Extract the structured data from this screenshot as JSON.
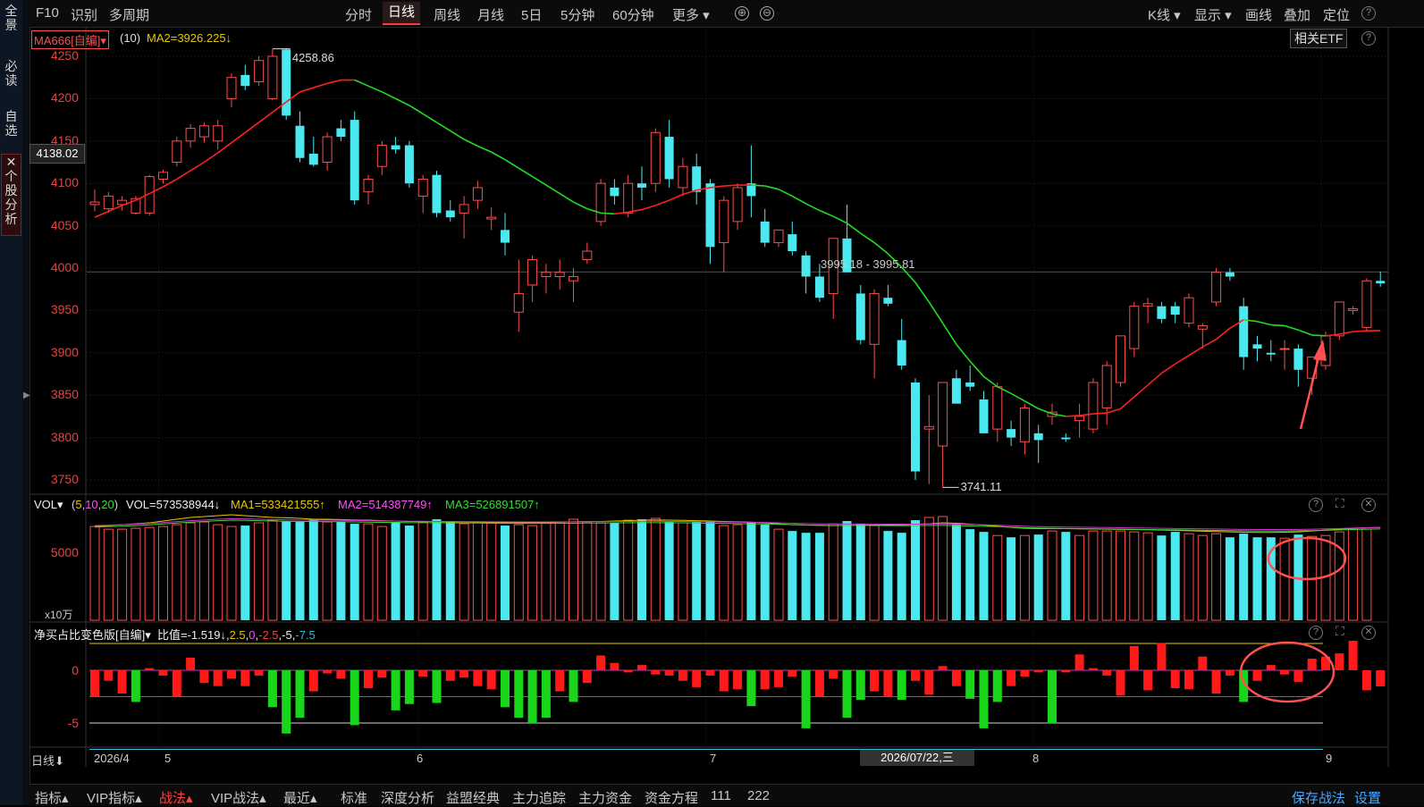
{
  "leftbar": {
    "tabs": [
      {
        "label": "全景"
      },
      {
        "label": "必读"
      },
      {
        "label": "自选"
      },
      {
        "label": "✕个股分析"
      }
    ]
  },
  "topbar": {
    "left": [
      "F10",
      "识别",
      "多周期"
    ],
    "periods": [
      "分时",
      "日线",
      "周线",
      "月线",
      "5日",
      "5分钟",
      "60分钟",
      "更多 ▾"
    ],
    "active_period": "日线",
    "zoom_in": "⊕",
    "zoom_out": "⊖",
    "right": [
      "K线 ▾",
      "显示 ▾",
      "画线",
      "叠加",
      "定位"
    ],
    "help": "?"
  },
  "main_panel": {
    "indicator_name": "MA666[自编]▾",
    "param": "(10)",
    "ma2_label": "MA2=3926.225↓",
    "etf_button": "相关ETF",
    "help": "?",
    "current_price": "4138.02",
    "high_label": "4258.86",
    "low_label": "3741.11",
    "range_label": "3995.18 - 3995.81",
    "y_ticks": [
      "4250",
      "4200",
      "4150",
      "4100",
      "4050",
      "4000",
      "3950",
      "3900",
      "3850",
      "3800",
      "3750"
    ]
  },
  "vol_panel": {
    "name": "VOL▾",
    "params_open": "(",
    "p1": "5",
    "p2": "10",
    "p3": "20",
    "params_close": ")",
    "vol": "VOL=573538944↓",
    "ma1": "MA1=533421555↑",
    "ma2": "MA2=514387749↑",
    "ma3": "MA3=526891507↑",
    "y_tick": "5000",
    "unit": "x10万"
  },
  "net_panel": {
    "name": "净买占比变色版[自编]▾",
    "ratio": "比值=-1.519↓",
    "v1": "2.5",
    "v2": "0",
    "v3": "-2.5",
    "v4": "-5",
    "v5": "-7.5",
    "y_ticks": [
      "0",
      "-5"
    ]
  },
  "xaxis": {
    "period_label": "日线⬇",
    "ticks": [
      "2026/4",
      "5",
      "6",
      "7",
      "8",
      "9"
    ],
    "cursor_date": "2026/07/22,三"
  },
  "bottombar": {
    "items": [
      "指标▴",
      "VIP指标▴",
      "战法▴",
      "VIP战法▴",
      "最近▴",
      "标准",
      "深度分析",
      "益盟经典",
      "主力追踪",
      "主力资金",
      "资金方程",
      "111",
      "222"
    ],
    "active_item": "战法▴",
    "right": [
      "保存战法",
      "设置"
    ]
  },
  "colors": {
    "up": "#ff4d4d",
    "down": "#4be8f0",
    "ma_up": "#ff2020",
    "ma_down": "#22dd22",
    "vol_up_fill": "#000000",
    "net_pos": "#ff1a1a",
    "net_neg": "#1ad61a",
    "annotation": "#ff5050"
  },
  "chart_data": {
    "type": "candlestick",
    "title": "",
    "price_range": [
      3730,
      4265
    ],
    "candles": [
      {
        "o": 4075,
        "h": 4093,
        "l": 4067,
        "c": 4078
      },
      {
        "o": 4070,
        "h": 4090,
        "l": 4065,
        "c": 4085
      },
      {
        "o": 4075,
        "h": 4085,
        "l": 4068,
        "c": 4080
      },
      {
        "o": 4065,
        "h": 4085,
        "l": 4063,
        "c": 4082
      },
      {
        "o": 4065,
        "h": 4110,
        "l": 4062,
        "c": 4108
      },
      {
        "o": 4105,
        "h": 4116,
        "l": 4100,
        "c": 4113
      },
      {
        "o": 4125,
        "h": 4155,
        "l": 4120,
        "c": 4150
      },
      {
        "o": 4150,
        "h": 4170,
        "l": 4142,
        "c": 4165
      },
      {
        "o": 4155,
        "h": 4172,
        "l": 4148,
        "c": 4168
      },
      {
        "o": 4150,
        "h": 4175,
        "l": 4140,
        "c": 4168
      },
      {
        "o": 4200,
        "h": 4230,
        "l": 4190,
        "c": 4225
      },
      {
        "o": 4228,
        "h": 4240,
        "l": 4210,
        "c": 4215
      },
      {
        "o": 4220,
        "h": 4250,
        "l": 4215,
        "c": 4245
      },
      {
        "o": 4200,
        "h": 4258.86,
        "l": 4198,
        "c": 4250
      },
      {
        "o": 4258,
        "h": 4259,
        "l": 4175,
        "c": 4180
      },
      {
        "o": 4168,
        "h": 4185,
        "l": 4125,
        "c": 4130
      },
      {
        "o": 4135,
        "h": 4155,
        "l": 4120,
        "c": 4122
      },
      {
        "o": 4125,
        "h": 4160,
        "l": 4115,
        "c": 4155
      },
      {
        "o": 4165,
        "h": 4175,
        "l": 4150,
        "c": 4155
      },
      {
        "o": 4175,
        "h": 4185,
        "l": 4075,
        "c": 4080
      },
      {
        "o": 4090,
        "h": 4110,
        "l": 4075,
        "c": 4105
      },
      {
        "o": 4120,
        "h": 4150,
        "l": 4110,
        "c": 4145
      },
      {
        "o": 4145,
        "h": 4155,
        "l": 4135,
        "c": 4140
      },
      {
        "o": 4145,
        "h": 4150,
        "l": 4095,
        "c": 4100
      },
      {
        "o": 4085,
        "h": 4110,
        "l": 4065,
        "c": 4105
      },
      {
        "o": 4110,
        "h": 4115,
        "l": 4060,
        "c": 4065
      },
      {
        "o": 4068,
        "h": 4080,
        "l": 4055,
        "c": 4060
      },
      {
        "o": 4065,
        "h": 4085,
        "l": 4035,
        "c": 4075
      },
      {
        "o": 4080,
        "h": 4103,
        "l": 4070,
        "c": 4095
      },
      {
        "o": 4058,
        "h": 4072,
        "l": 4045,
        "c": 4060
      },
      {
        "o": 4045,
        "h": 4065,
        "l": 4015,
        "c": 4030
      },
      {
        "o": 3948,
        "h": 4010,
        "l": 3925,
        "c": 3970
      },
      {
        "o": 3980,
        "h": 4015,
        "l": 3960,
        "c": 4010
      },
      {
        "o": 3990,
        "h": 4005,
        "l": 3970,
        "c": 3995
      },
      {
        "o": 3990,
        "h": 4010,
        "l": 3975,
        "c": 3995
      },
      {
        "o": 3985,
        "h": 4000,
        "l": 3960,
        "c": 3990
      },
      {
        "o": 4010,
        "h": 4030,
        "l": 4005,
        "c": 4020
      },
      {
        "o": 4055,
        "h": 4105,
        "l": 4050,
        "c": 4100
      },
      {
        "o": 4095,
        "h": 4105,
        "l": 4075,
        "c": 4085
      },
      {
        "o": 4065,
        "h": 4110,
        "l": 4060,
        "c": 4100
      },
      {
        "o": 4100,
        "h": 4120,
        "l": 4080,
        "c": 4095
      },
      {
        "o": 4100,
        "h": 4165,
        "l": 4090,
        "c": 4160
      },
      {
        "o": 4155,
        "h": 4175,
        "l": 4095,
        "c": 4105
      },
      {
        "o": 4095,
        "h": 4130,
        "l": 4085,
        "c": 4120
      },
      {
        "o": 4120,
        "h": 4135,
        "l": 4075,
        "c": 4090
      },
      {
        "o": 4100,
        "h": 4105,
        "l": 4005,
        "c": 4025
      },
      {
        "o": 4030,
        "h": 4085,
        "l": 3995,
        "c": 4080
      },
      {
        "o": 4055,
        "h": 4100,
        "l": 4045,
        "c": 4095
      },
      {
        "o": 4100,
        "h": 4145,
        "l": 4060,
        "c": 4085
      },
      {
        "o": 4055,
        "h": 4070,
        "l": 4025,
        "c": 4030
      },
      {
        "o": 4030,
        "h": 4045,
        "l": 4025,
        "c": 4045
      },
      {
        "o": 4040,
        "h": 4055,
        "l": 4015,
        "c": 4020
      },
      {
        "o": 4015,
        "h": 4020,
        "l": 3970,
        "c": 3990
      },
      {
        "o": 3990,
        "h": 4005,
        "l": 3960,
        "c": 3965
      },
      {
        "o": 3970,
        "h": 4035,
        "l": 3940,
        "c": 4035
      },
      {
        "o": 4035,
        "h": 4075,
        "l": 3995,
        "c": 3995
      },
      {
        "o": 3970,
        "h": 3980,
        "l": 3910,
        "c": 3915
      },
      {
        "o": 3910,
        "h": 3975,
        "l": 3870,
        "c": 3970
      },
      {
        "o": 3965,
        "h": 3980,
        "l": 3955,
        "c": 3958
      },
      {
        "o": 3915,
        "h": 3940,
        "l": 3880,
        "c": 3885
      },
      {
        "o": 3865,
        "h": 3870,
        "l": 3750,
        "c": 3760
      },
      {
        "o": 3810,
        "h": 3850,
        "l": 3745,
        "c": 3813
      },
      {
        "o": 3790,
        "h": 3865,
        "l": 3741.11,
        "c": 3865
      },
      {
        "o": 3870,
        "h": 3880,
        "l": 3840,
        "c": 3840
      },
      {
        "o": 3865,
        "h": 3885,
        "l": 3855,
        "c": 3860
      },
      {
        "o": 3845,
        "h": 3855,
        "l": 3805,
        "c": 3805
      },
      {
        "o": 3810,
        "h": 3865,
        "l": 3795,
        "c": 3860
      },
      {
        "o": 3810,
        "h": 3820,
        "l": 3790,
        "c": 3800
      },
      {
        "o": 3795,
        "h": 3840,
        "l": 3780,
        "c": 3835
      },
      {
        "o": 3805,
        "h": 3815,
        "l": 3770,
        "c": 3797
      },
      {
        "o": 3825,
        "h": 3840,
        "l": 3815,
        "c": 3830
      },
      {
        "o": 3800,
        "h": 3805,
        "l": 3795,
        "c": 3798
      },
      {
        "o": 3820,
        "h": 3840,
        "l": 3800,
        "c": 3825
      },
      {
        "o": 3810,
        "h": 3870,
        "l": 3805,
        "c": 3865
      },
      {
        "o": 3835,
        "h": 3890,
        "l": 3815,
        "c": 3885
      },
      {
        "o": 3865,
        "h": 3920,
        "l": 3860,
        "c": 3920
      },
      {
        "o": 3905,
        "h": 3960,
        "l": 3895,
        "c": 3955
      },
      {
        "o": 3955,
        "h": 3965,
        "l": 3935,
        "c": 3958
      },
      {
        "o": 3955,
        "h": 3960,
        "l": 3935,
        "c": 3940
      },
      {
        "o": 3955,
        "h": 3960,
        "l": 3935,
        "c": 3945
      },
      {
        "o": 3935,
        "h": 3970,
        "l": 3930,
        "c": 3965
      },
      {
        "o": 3928,
        "h": 3935,
        "l": 3905,
        "c": 3932
      },
      {
        "o": 3960,
        "h": 4000,
        "l": 3955,
        "c": 3995
      },
      {
        "o": 3995,
        "h": 4000,
        "l": 3985,
        "c": 3990
      },
      {
        "o": 3955,
        "h": 3965,
        "l": 3880,
        "c": 3895
      },
      {
        "o": 3910,
        "h": 3920,
        "l": 3890,
        "c": 3905
      },
      {
        "o": 3900,
        "h": 3915,
        "l": 3890,
        "c": 3898
      },
      {
        "o": 3905,
        "h": 3915,
        "l": 3880,
        "c": 3905
      },
      {
        "o": 3905,
        "h": 3910,
        "l": 3860,
        "c": 3880
      },
      {
        "o": 3870,
        "h": 3895,
        "l": 3850,
        "c": 3895
      },
      {
        "o": 3885,
        "h": 3925,
        "l": 3880,
        "c": 3920
      },
      {
        "o": 3920,
        "h": 3960,
        "l": 3915,
        "c": 3960
      },
      {
        "o": 3950,
        "h": 3955,
        "l": 3945,
        "c": 3952
      },
      {
        "o": 3930,
        "h": 3988,
        "l": 3925,
        "c": 3985
      },
      {
        "o": 3985,
        "h": 3995.81,
        "l": 3978,
        "c": 3982
      }
    ],
    "ma": [
      4060,
      4067,
      4074,
      4080,
      4088,
      4096,
      4105,
      4115,
      4125,
      4136,
      4148,
      4160,
      4172,
      4184,
      4196,
      4208,
      4213,
      4218,
      4222,
      4222,
      4215,
      4208,
      4200,
      4192,
      4182,
      4172,
      4162,
      4152,
      4144,
      4137,
      4128,
      4118,
      4108,
      4098,
      4088,
      4078,
      4070,
      4065,
      4064,
      4066,
      4069,
      4074,
      4080,
      4087,
      4092,
      4095,
      4097,
      4098,
      4098,
      4097,
      4093,
      4085,
      4076,
      4068,
      4061,
      4053,
      4041,
      4030,
      4017,
      4001,
      3983,
      3960,
      3935,
      3910,
      3890,
      3872,
      3860,
      3852,
      3843,
      3834,
      3828,
      3825,
      3826,
      3828,
      3829,
      3834,
      3848,
      3862,
      3876,
      3887,
      3897,
      3907,
      3916,
      3929,
      3939,
      3937,
      3933,
      3932,
      3927,
      3921,
      3920,
      3922,
      3925,
      3926,
      3926.225
    ],
    "volume": [
      520,
      505,
      505,
      510,
      515,
      520,
      530,
      540,
      545,
      530,
      520,
      525,
      540,
      555,
      550,
      545,
      560,
      545,
      545,
      535,
      535,
      520,
      545,
      525,
      545,
      560,
      545,
      535,
      545,
      540,
      525,
      530,
      525,
      540,
      545,
      560,
      545,
      540,
      540,
      555,
      560,
      565,
      545,
      540,
      545,
      545,
      525,
      530,
      545,
      530,
      505,
      495,
      485,
      485,
      535,
      550,
      535,
      525,
      495,
      485,
      555,
      570,
      575,
      530,
      505,
      490,
      470,
      460,
      470,
      475,
      495,
      490,
      470,
      495,
      495,
      495,
      490,
      485,
      470,
      490,
      480,
      470,
      480,
      460,
      480,
      460,
      460,
      455,
      475,
      465,
      470,
      490,
      505,
      505
    ],
    "volume_ma": [
      520,
      525,
      530,
      535,
      540,
      550,
      560,
      570,
      575,
      580,
      585,
      580,
      575,
      570,
      568,
      565,
      560,
      560,
      558,
      555,
      555,
      552,
      550,
      548,
      548,
      547,
      546,
      545,
      544,
      543,
      542,
      540,
      540,
      542,
      544,
      546,
      548,
      548,
      550,
      552,
      555,
      556,
      555,
      554,
      552,
      550,
      548,
      546,
      544,
      540,
      535,
      530,
      528,
      526,
      525,
      526,
      527,
      528,
      528,
      530,
      532,
      535,
      540,
      538,
      533,
      528,
      522,
      515,
      510,
      508,
      508,
      508,
      507,
      506,
      505,
      504,
      503,
      502,
      500,
      498,
      496,
      494,
      492,
      490,
      488,
      487,
      487,
      488,
      490,
      495,
      500,
      505,
      510,
      513,
      515
    ],
    "volume_ma_b": [
      525,
      527,
      530,
      533,
      537,
      542,
      547,
      552,
      556,
      560,
      563,
      562,
      560,
      558,
      557,
      556,
      555,
      555,
      554,
      553,
      552,
      551,
      550,
      549,
      549,
      548,
      548,
      547,
      547,
      546,
      546,
      545,
      545,
      545,
      546,
      546,
      547,
      547,
      548,
      548,
      549,
      549,
      548,
      548,
      547,
      546,
      545,
      544,
      543,
      542,
      540,
      538,
      536,
      535,
      534,
      534,
      534,
      534,
      533,
      533,
      533,
      534,
      534,
      533,
      531,
      529,
      527,
      524,
      521,
      519,
      518,
      517,
      516,
      515,
      514,
      513,
      512,
      511,
      510,
      509,
      508,
      507,
      506,
      505,
      504,
      503,
      503,
      503,
      504,
      505,
      507,
      509,
      511,
      513,
      514
    ],
    "net_ratio": [
      -2.5,
      -1,
      -2.2,
      -3,
      0.2,
      -0.5,
      -2.5,
      1.2,
      -1.2,
      -1.5,
      -0.8,
      -1.5,
      -0.5,
      -3.5,
      -6,
      -4.5,
      -2,
      -0.3,
      -0.8,
      -5.2,
      -1.7,
      -0.7,
      -3.8,
      -3.2,
      -0.6,
      -3.1,
      -1,
      -0.7,
      -1.5,
      -1.8,
      -3.5,
      -4.5,
      -5,
      -4.5,
      -2,
      -3,
      -1.2,
      1.4,
      0.7,
      -0.2,
      0.5,
      -0.4,
      -0.5,
      -1,
      -1.6,
      -0.5,
      -2,
      -1.8,
      -3.4,
      -1.8,
      -1.6,
      -0.6,
      -5.5,
      -2.5,
      -0.8,
      -4.5,
      -2.8,
      -2,
      -2.5,
      -2.8,
      -1,
      -2.3,
      0.4,
      -1.5,
      -2.7,
      -5.5,
      -3,
      -1.5,
      -0.6,
      -0.2,
      -5,
      -0.2,
      1.5,
      0.2,
      -0.5,
      -2.4,
      2.3,
      -1.9,
      2.6,
      -1.7,
      -1.8,
      1.3,
      -2.2,
      -0.5,
      -3,
      -1,
      0.5,
      -0.4,
      -1.1,
      1.1,
      1.3,
      1.6,
      2.8,
      -1.9,
      -1.519
    ]
  }
}
